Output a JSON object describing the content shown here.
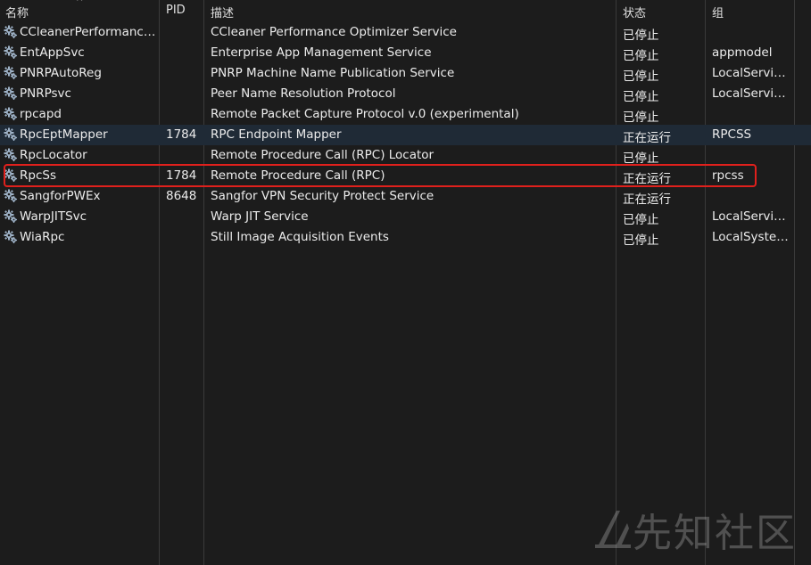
{
  "columns": {
    "name": "名称",
    "pid": "PID",
    "description": "描述",
    "status": "状态",
    "group": "组"
  },
  "sort_indicator": "^",
  "rows": [
    {
      "name": "CCleanerPerformanceO...",
      "pid": "",
      "description": "CCleaner Performance Optimizer Service",
      "status": "已停止",
      "group": ""
    },
    {
      "name": "EntAppSvc",
      "pid": "",
      "description": "Enterprise App Management Service",
      "status": "已停止",
      "group": "appmodel"
    },
    {
      "name": "PNRPAutoReg",
      "pid": "",
      "description": "PNRP Machine Name Publication Service",
      "status": "已停止",
      "group": "LocalService..."
    },
    {
      "name": "PNRPsvc",
      "pid": "",
      "description": "Peer Name Resolution Protocol",
      "status": "已停止",
      "group": "LocalService..."
    },
    {
      "name": "rpcapd",
      "pid": "",
      "description": "Remote Packet Capture Protocol v.0 (experimental)",
      "status": "已停止",
      "group": ""
    },
    {
      "name": "RpcEptMapper",
      "pid": "1784",
      "description": "RPC Endpoint Mapper",
      "status": "正在运行",
      "group": "RPCSS"
    },
    {
      "name": "RpcLocator",
      "pid": "",
      "description": "Remote Procedure Call (RPC) Locator",
      "status": "已停止",
      "group": ""
    },
    {
      "name": "RpcSs",
      "pid": "1784",
      "description": "Remote Procedure Call (RPC)",
      "status": "正在运行",
      "group": "rpcss"
    },
    {
      "name": "SangforPWEx",
      "pid": "8648",
      "description": "Sangfor VPN Security Protect Service",
      "status": "正在运行",
      "group": ""
    },
    {
      "name": "WarpJITSvc",
      "pid": "",
      "description": "Warp JIT Service",
      "status": "已停止",
      "group": "LocalService..."
    },
    {
      "name": "WiaRpc",
      "pid": "",
      "description": "Still Image Acquisition Events",
      "status": "已停止",
      "group": "LocalSystem..."
    }
  ],
  "selected_row_index": 5,
  "highlighted_row_index": 7,
  "colors": {
    "background": "#1c1c1c",
    "selected_row": "#1f2a36",
    "highlight_box": "#e0201c"
  },
  "icons": {
    "service": "gear-icon",
    "watermark": "logo-icon"
  },
  "watermark": {
    "text": "先知社区"
  }
}
